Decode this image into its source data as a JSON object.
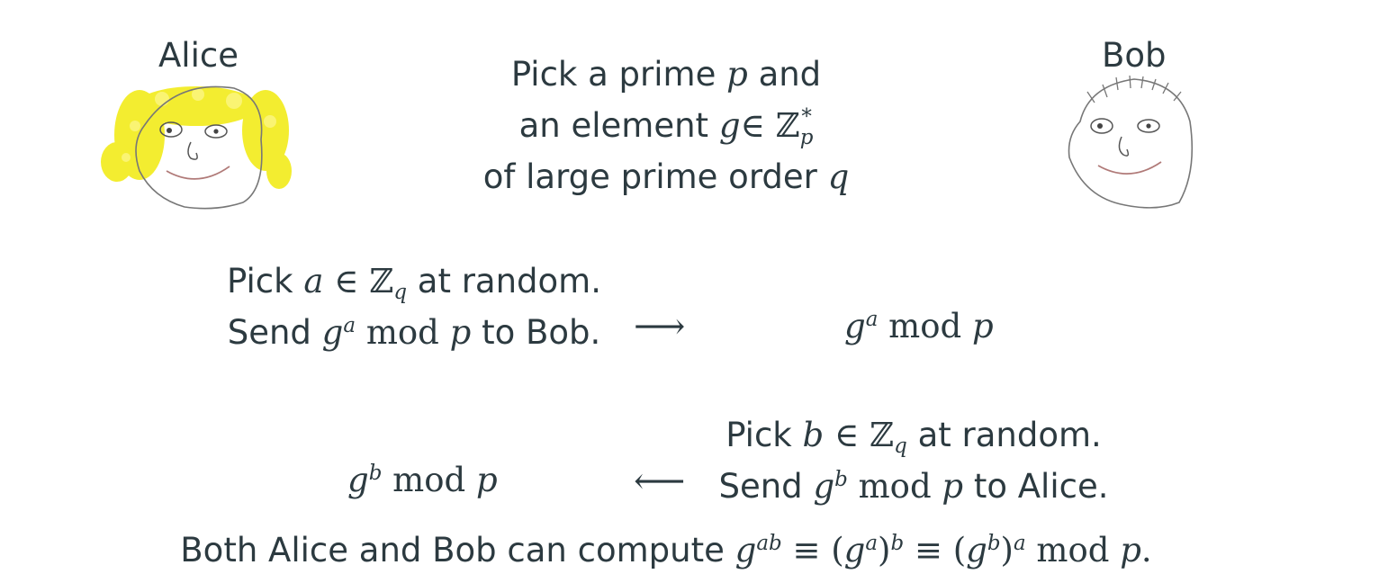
{
  "participants": {
    "alice": "Alice",
    "bob": "Bob"
  },
  "setup": {
    "line1_pre": "Pick a prime",
    "var_p": "p",
    "line1_post": "and",
    "line2_pre": "an element",
    "var_g": "g",
    "in_symbol": "∈",
    "group_Z": "ℤ",
    "group_sup": "*",
    "group_sub": "p",
    "line3_pre": "of large prime order",
    "var_q": "q"
  },
  "alice_step": {
    "pick_pre": "Pick",
    "var_a": "a",
    "in_symbol": "∈",
    "group_Z": "ℤ",
    "group_sub": "q",
    "pick_post": "at random.",
    "send_pre": "Send",
    "base": "g",
    "exp": "a",
    "mod": "mod",
    "var_p": "p",
    "send_post": "to Bob."
  },
  "arrow_right": "⟶",
  "bob_receives": {
    "base": "g",
    "exp": "a",
    "mod": "mod",
    "var_p": "p"
  },
  "bob_step": {
    "pick_pre": "Pick",
    "var_b": "b",
    "in_symbol": "∈",
    "group_Z": "ℤ",
    "group_sub": "q",
    "pick_post": "at random.",
    "send_pre": "Send",
    "base": "g",
    "exp": "b",
    "mod": "mod",
    "var_p": "p",
    "send_post": "to Alice."
  },
  "arrow_left": "⟵",
  "alice_receives": {
    "base": "g",
    "exp": "b",
    "mod": "mod",
    "var_p": "p"
  },
  "conclusion": {
    "text": "Both Alice and Bob can compute",
    "g": "g",
    "exp_ab": "ab",
    "equiv": "≡",
    "open": "(",
    "close": ")",
    "exp_a": "a",
    "exp_b": "b",
    "mod": "mod",
    "var_p": "p",
    "period": "."
  },
  "colors": {
    "text": "#2c3a40",
    "hair_alice": "#f2ec1a",
    "face_outline": "#777777",
    "mouth": "#b07a78"
  },
  "icons": {
    "alice": "alice-face-drawing-icon",
    "bob": "bob-face-drawing-icon"
  }
}
